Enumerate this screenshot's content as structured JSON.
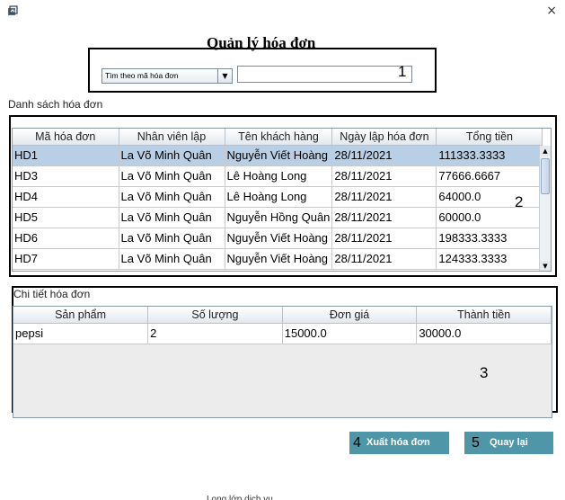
{
  "window": {
    "app_icon": "java-app-icon",
    "close_glyph": "×"
  },
  "title": "Quản lý hóa đơn",
  "search": {
    "mode_selected": "Tìm theo mã hóa đơn",
    "value": "",
    "marker": "1"
  },
  "list_section": {
    "label": "Danh sách hóa đơn",
    "marker": "2",
    "columns": [
      "Mã hóa đơn",
      "Nhân viên lập",
      "Tên khách hàng",
      "Ngày lập hóa đơn",
      "Tổng tiền"
    ],
    "rows": [
      [
        "HD1",
        "La Võ Minh Quân",
        "Nguyễn Viết Hoàng",
        "28/11/2021",
        "111333.3333"
      ],
      [
        "HD3",
        "La Võ Minh Quân",
        "Lê Hoàng Long",
        "28/11/2021",
        "77666.6667"
      ],
      [
        "HD4",
        "La Võ Minh Quân",
        "Lê Hoàng Long",
        "28/11/2021",
        "64000.0"
      ],
      [
        "HD5",
        "La Võ Minh Quân",
        "Nguyễn Hồng Quân",
        "28/11/2021",
        "60000.0"
      ],
      [
        "HD6",
        "La Võ Minh Quân",
        "Nguyễn Viết Hoàng",
        "28/11/2021",
        "198333.3333"
      ],
      [
        "HD7",
        "La Võ Minh Quân",
        "Nguyễn Viết Hoàng",
        "28/11/2021",
        "124333.3333"
      ]
    ],
    "selected_row": 0
  },
  "detail_section": {
    "label": "Chi tiết hóa đơn",
    "marker": "3",
    "columns": [
      "Sản phẩm",
      "Số lượng",
      "Đơn giá",
      "Thành tiền"
    ],
    "rows": [
      [
        "pepsi",
        "2",
        "15000.0",
        "30000.0"
      ]
    ]
  },
  "buttons": {
    "export": {
      "label": "Xuất hóa đơn",
      "marker": "4"
    },
    "back": {
      "label": "Quay lại",
      "marker": "5"
    }
  },
  "footer_clipped_text": "Long lớp dịch vụ",
  "colors": {
    "button_bg": "#4f97a8",
    "selected_row": "#b8cfe5",
    "header_bg": "#e3e8ee"
  }
}
